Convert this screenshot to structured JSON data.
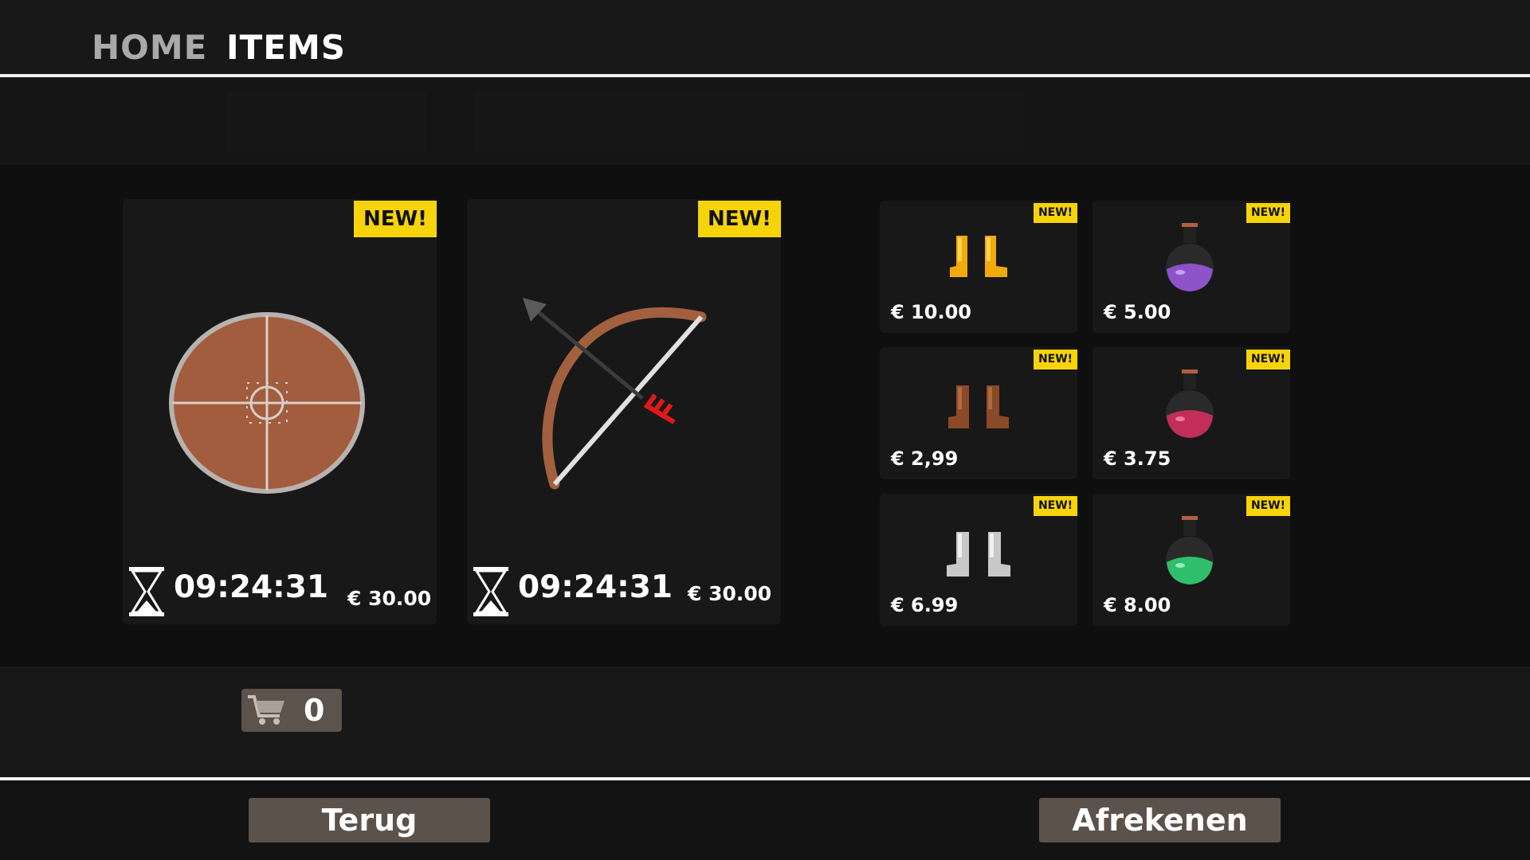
{
  "nav": {
    "home_label": "HOME",
    "items_label": "ITEMS"
  },
  "featured": [
    {
      "badge": "NEW!",
      "icon": "shield-icon",
      "timer": "09:24:31",
      "price": "€ 30.00"
    },
    {
      "badge": "NEW!",
      "icon": "bow-and-arrow-icon",
      "timer": "09:24:31",
      "price": "€ 30.00"
    }
  ],
  "shop_items": [
    {
      "badge": "NEW!",
      "icon": "yellow-boots-icon",
      "price": "€ 10.00"
    },
    {
      "badge": "NEW!",
      "icon": "purple-potion-icon",
      "price": "€ 5.00"
    },
    {
      "badge": "NEW!",
      "icon": "brown-boots-icon",
      "price": "€ 2,99"
    },
    {
      "badge": "NEW!",
      "icon": "red-potion-icon",
      "price": "€ 3.75"
    },
    {
      "badge": "NEW!",
      "icon": "white-boots-icon",
      "price": "€ 6.99"
    },
    {
      "badge": "NEW!",
      "icon": "green-potion-icon",
      "price": "€ 8.00"
    }
  ],
  "cart": {
    "count": "0",
    "icon": "shopping-cart-icon"
  },
  "footer": {
    "back_label": "Terug",
    "checkout_label": "Afrekenen"
  },
  "colors": {
    "badge": "#f7d40a",
    "button": "#5b524b",
    "background": "#181818"
  }
}
